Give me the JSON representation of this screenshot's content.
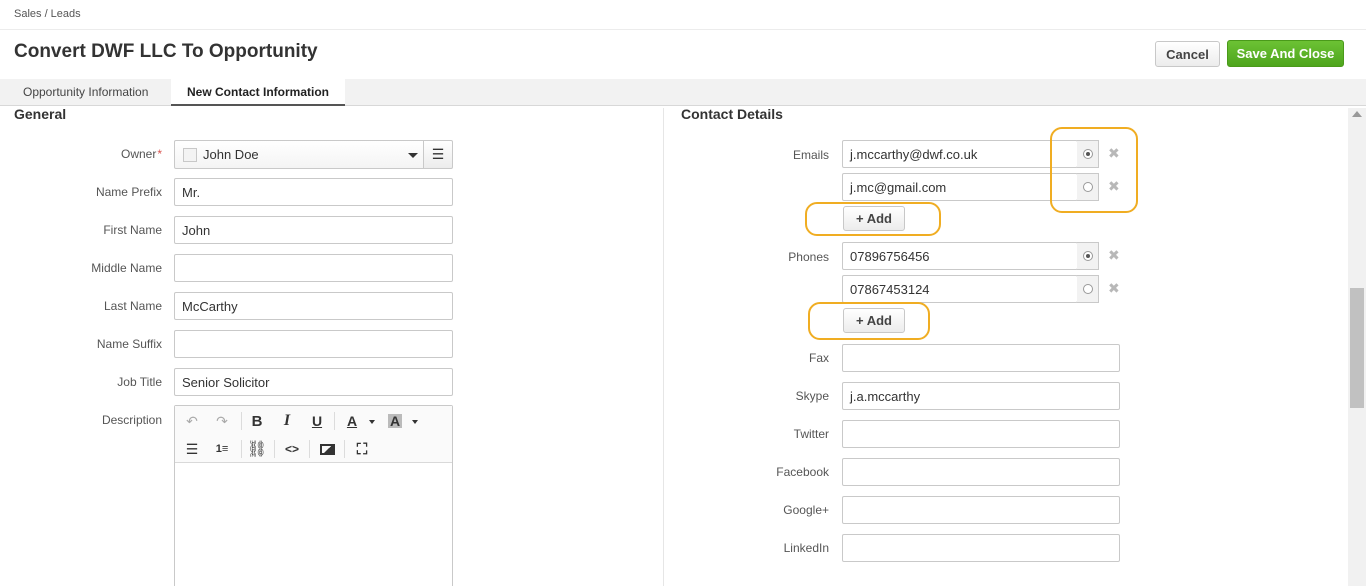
{
  "breadcrumb": "Sales / Leads",
  "page_title": "Convert DWF LLC To Opportunity",
  "actions": {
    "cancel": "Cancel",
    "save_close": "Save And Close"
  },
  "tabs": [
    "Opportunity Information",
    "New Contact Information"
  ],
  "active_tab": "New Contact Information",
  "general": {
    "heading": "General",
    "owner": {
      "label": "Owner",
      "required_mark": "*",
      "value": "John Doe"
    },
    "name_prefix": {
      "label": "Name Prefix",
      "value": "Mr."
    },
    "first_name": {
      "label": "First Name",
      "value": "John"
    },
    "middle_name": {
      "label": "Middle Name",
      "value": ""
    },
    "last_name": {
      "label": "Last Name",
      "value": "McCarthy"
    },
    "name_suffix": {
      "label": "Name Suffix",
      "value": ""
    },
    "job_title": {
      "label": "Job Title",
      "value": "Senior Solicitor"
    },
    "description": {
      "label": "Description",
      "value": ""
    }
  },
  "editor_toolbar": [
    "undo-icon",
    "redo-icon",
    "bold-icon",
    "italic-icon",
    "underline-icon",
    "text-color-icon",
    "background-color-icon",
    "bulleted-list-icon",
    "numbered-list-icon",
    "link-icon",
    "source-code-icon",
    "image-icon",
    "fullscreen-icon"
  ],
  "contact_details": {
    "heading": "Contact Details",
    "emails": {
      "label": "Emails",
      "values": [
        "j.mccarthy@dwf.co.uk",
        "j.mc@gmail.com"
      ],
      "primary_index": 0
    },
    "phones": {
      "label": "Phones",
      "values": [
        "07896756456",
        "07867453124"
      ],
      "primary_index": 0
    },
    "add_label": "+ Add",
    "fax": {
      "label": "Fax",
      "value": ""
    },
    "skype": {
      "label": "Skype",
      "value": "j.a.mccarthy"
    },
    "twitter": {
      "label": "Twitter",
      "value": ""
    },
    "facebook": {
      "label": "Facebook",
      "value": ""
    },
    "google_plus": {
      "label": "Google+",
      "value": ""
    },
    "linkedin": {
      "label": "LinkedIn",
      "value": ""
    }
  },
  "colors": {
    "save_green": "#5cb82a",
    "highlight_orange": "#f0ad22",
    "required_red": "#d9534f"
  }
}
